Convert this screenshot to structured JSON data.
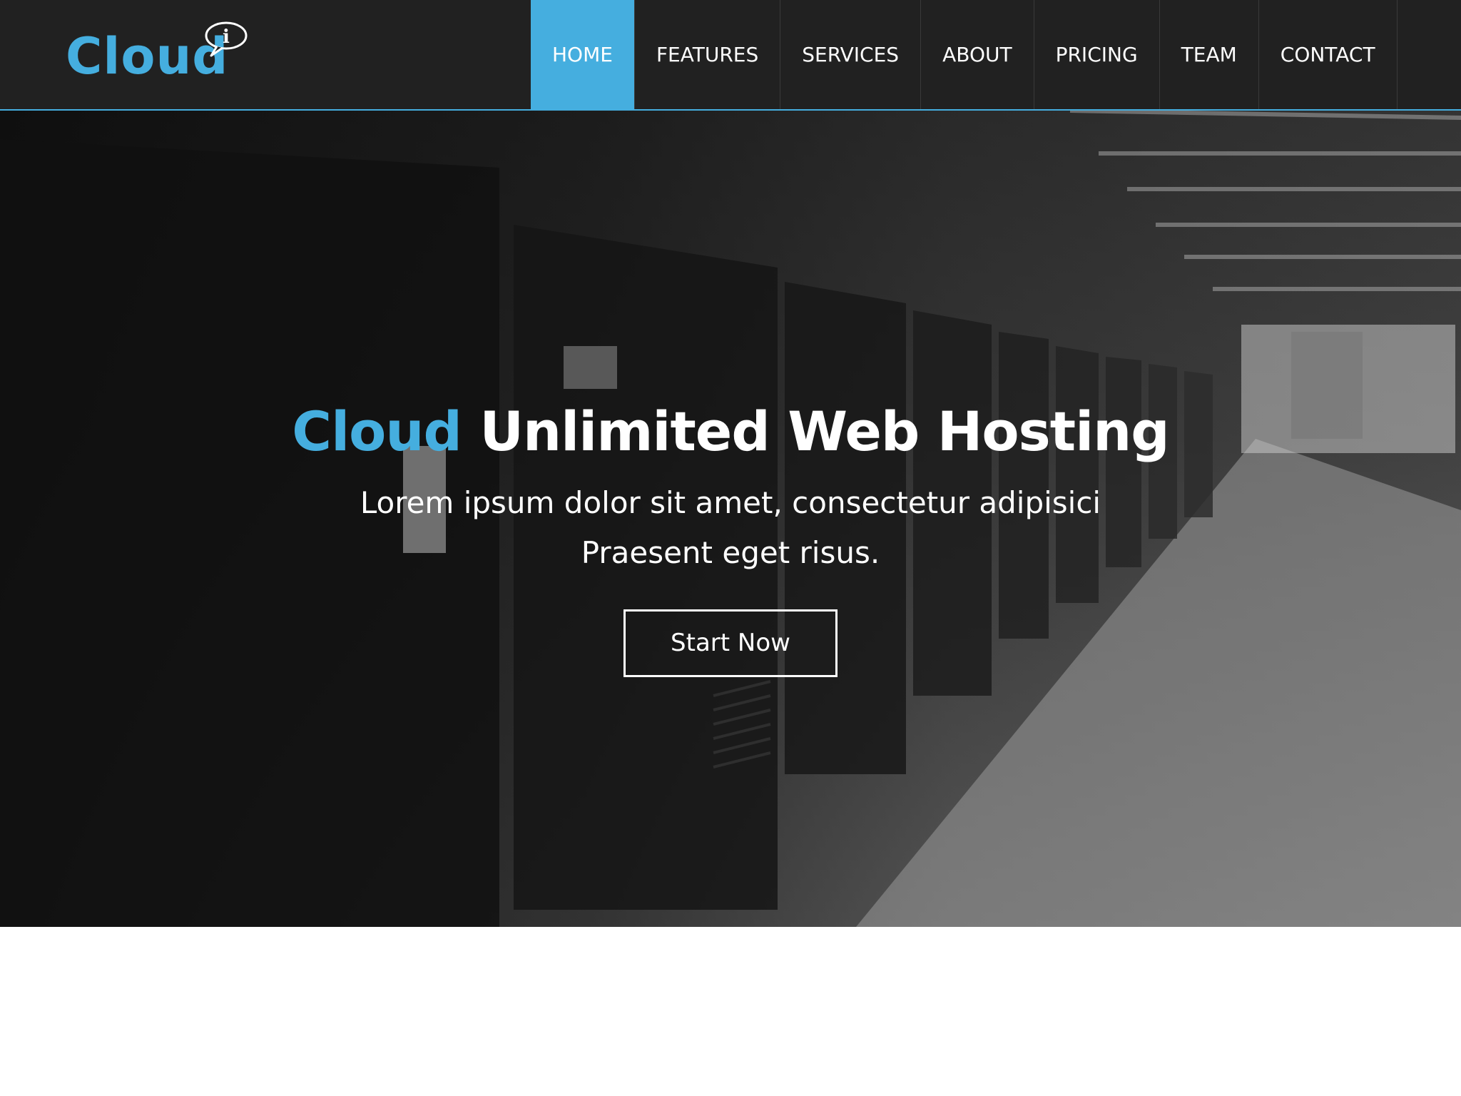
{
  "brand": {
    "logo_text": "Cloud",
    "logo_badge": "i",
    "accent_color": "#45aedf"
  },
  "nav": {
    "items": [
      {
        "label": "HOME",
        "active": true
      },
      {
        "label": "FEATURES",
        "active": false
      },
      {
        "label": "SERVICES",
        "active": false
      },
      {
        "label": "ABOUT",
        "active": false
      },
      {
        "label": "PRICING",
        "active": false
      },
      {
        "label": "TEAM",
        "active": false
      },
      {
        "label": "CONTACT",
        "active": false
      }
    ]
  },
  "hero": {
    "title_accent": "Cloud",
    "title_rest": "Unlimited Web Hosting",
    "subtitle_line1": "Lorem ipsum dolor sit amet, consectetur adipisici",
    "subtitle_line2": "Praesent eget risus.",
    "cta_label": "Start Now"
  }
}
